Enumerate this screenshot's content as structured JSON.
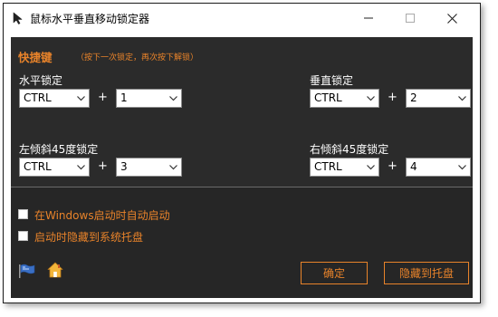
{
  "window": {
    "title": "鼠标水平垂直移动锁定器"
  },
  "hotkeys": {
    "title": "快捷键",
    "hint": "（按下一次锁定，再次按下解锁）",
    "groups": [
      {
        "label": "水平锁定",
        "modifier": "CTRL",
        "plus": "+",
        "key": "1"
      },
      {
        "label": "垂直锁定",
        "modifier": "CTRL",
        "plus": "+",
        "key": "2"
      },
      {
        "label": "左倾斜45度锁定",
        "modifier": "CTRL",
        "plus": "+",
        "key": "3"
      },
      {
        "label": "右倾斜45度锁定",
        "modifier": "CTRL",
        "plus": "+",
        "key": "4"
      }
    ]
  },
  "options": {
    "startup_label": "在Windows启动时自动启动",
    "tray_label": "启动时隐藏到系统托盘",
    "startup_checked": false,
    "tray_checked": false
  },
  "buttons": {
    "ok": "确定",
    "hide": "隐藏到托盘"
  },
  "colors": {
    "accent": "#e8832a",
    "panel": "#2b2b2b",
    "panel_dark": "#262626"
  },
  "icons": {
    "app": "cursor-arrow-icon",
    "minimize": "minimize-icon",
    "maximize": "maximize-icon",
    "close": "close-icon",
    "dropdown": "chevron-down-icon",
    "flag": "flag-icon",
    "home": "home-icon"
  }
}
